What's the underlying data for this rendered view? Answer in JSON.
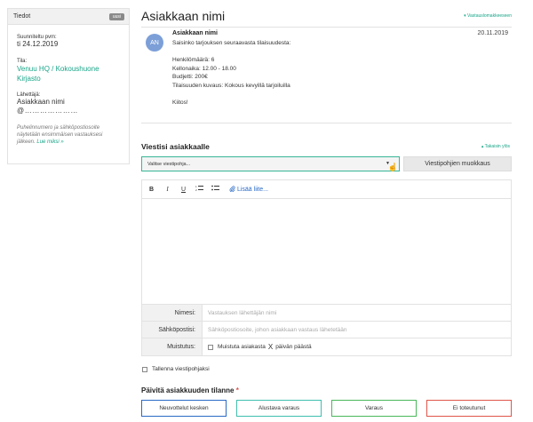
{
  "sidebar": {
    "header": "Tiedot",
    "badge": "uusi",
    "planned_label": "Suunniteltu pvm:",
    "planned_value": "ti 24.12.2019",
    "space_label": "Tila:",
    "space_value": "Venuu HQ / Kokoushuone Kirjasto",
    "sender_label": "Lähettäjä:",
    "sender_name": "Asiakkaan nimi",
    "sender_email": "@…………………",
    "note": "Puhelinnumero ja sähköpostiosoite näytetään ensimmäisen vastauksesi jälkeen.",
    "note_link": "Lue miksi »"
  },
  "main": {
    "title": "Asiakkaan nimi",
    "back_link": "▾ Vastauslomakkeeseen"
  },
  "message": {
    "avatar": "AN",
    "sender": "Asiakkaan nimi",
    "date": "20.11.2019",
    "lines": {
      "l1": "Saisinko tarjouksen seuraavasta tilaisuudesta:",
      "l2": "Henkilömäärä: 6",
      "l3": "Kellonaika: 12.00 - 18.00",
      "l4": "Budjetti: 200€",
      "l5": "Tilaisuuden kuvaus: Kokous kevyillä tarjoiluilla",
      "l6": "Kiitos!"
    }
  },
  "reply": {
    "title": "Viestisi asiakkaalle",
    "up_link": "▴ Takaisin ylös",
    "template_select": "Valitse viestipohja...",
    "edit_templates": "Viestipohjien muokkaus",
    "toolbar": {
      "bold": "B",
      "italic": "I",
      "underline": "U",
      "attach": "Lisää liite..."
    },
    "fields": {
      "name_label": "Nimesi:",
      "name_placeholder": "Vastauksen lähettäjän nimi",
      "email_label": "Sähköpostisi:",
      "email_placeholder": "Sähköpostiosoite, johon asiakkaan vastaus lähetetään",
      "reminder_label": "Muistutus:",
      "reminder_text_a": "Muistuta asiakasta",
      "reminder_x": "X",
      "reminder_text_b": "päivän päästä"
    },
    "save_template": "Tallenna viestipohjaksi"
  },
  "status": {
    "title": "Päivitä asiakkuuden tilanne",
    "required": "*",
    "buttons": {
      "negotiated": "Neuvottelut kesken",
      "tentative": "Alustava varaus",
      "booked": "Varaus",
      "not_realized": "Ei toteutunut"
    },
    "colors": {
      "negotiated": "#2a6bc6",
      "tentative": "#3fbfae",
      "booked": "#48b85a",
      "not_realized": "#e0554a"
    }
  },
  "colors": {
    "accent": "#18a589",
    "link_blue": "#2a6bc6"
  }
}
